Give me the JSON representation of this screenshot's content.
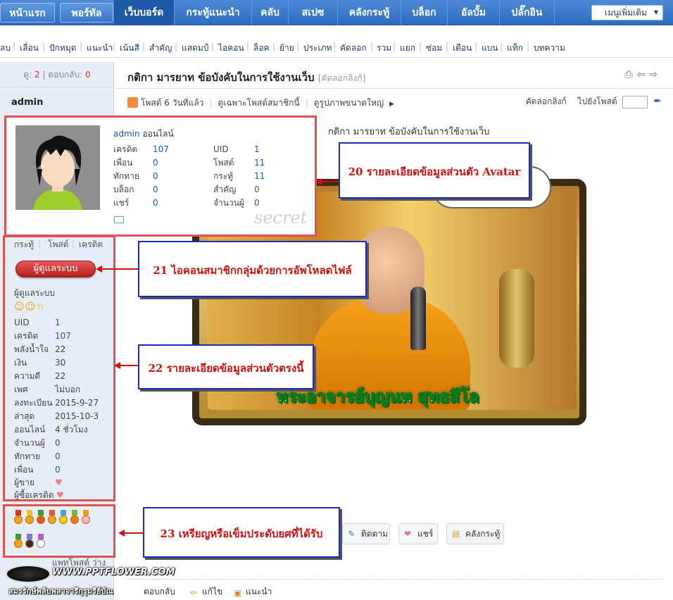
{
  "nav": {
    "items": [
      "หน้าแรก",
      "พอร์ทัล",
      "เว็บบอร์ด",
      "กระทู้แนะนำ",
      "คลับ",
      "สเปซ",
      "คลังกระทู้",
      "บล็อก",
      "อัลบั้ม",
      "ปลั๊กอิน"
    ],
    "more_menu": "เมนูเพิ่มเติม"
  },
  "modbar": {
    "items": [
      "ลบ",
      "เลื่อน",
      "ปักหมุด",
      "แนะนำ",
      "เน้นสี",
      "สำคัญ",
      "แสดมป์",
      "ไอคอน",
      "ล็อค",
      "ย้าย",
      "ประเภท",
      "คัดลอก",
      "รวม",
      "แยก",
      "ซ่อม",
      "เตือน",
      "แบน",
      "แท็ก",
      "บทความ"
    ]
  },
  "stats": {
    "views_label": "ดู:",
    "views": "2",
    "sep": "|",
    "replies_label": "ตอบกลับ:",
    "replies": "0"
  },
  "author": {
    "name": "admin"
  },
  "card": {
    "name": "admin",
    "status": "ออนไลน์",
    "rows": [
      [
        "เครดิต",
        "107",
        "UID",
        "1"
      ],
      [
        "เพื่อน",
        "0",
        "โพสต์",
        "11"
      ],
      [
        "ทักทาย",
        "0",
        "กระทู้",
        "11"
      ],
      [
        "บล็อก",
        "0",
        "สำคัญ",
        "0"
      ],
      [
        "แชร์",
        "0",
        "จำนวนผู้",
        "0"
      ]
    ],
    "watermark": "secret"
  },
  "side_tabs": [
    "กระทู้",
    "โพสต์",
    "เครดิต"
  ],
  "group": {
    "button": "ผู้ดูแลระบบ",
    "label": "ผู้ดูแลระบบ",
    "stars": "☺☺☆"
  },
  "profile": [
    [
      "UID",
      "1"
    ],
    [
      "เครดิต",
      "107"
    ],
    [
      "พลังน้ำใจ",
      "22"
    ],
    [
      "เงิน",
      "30"
    ],
    [
      "ความดี",
      "22"
    ],
    [
      "เพศ",
      "ไม่บอก"
    ],
    [
      "ลงทะเบียน",
      "2015-9-27"
    ],
    [
      "ล่าสุด",
      "2015-10-3"
    ],
    [
      "ออนไลน์",
      "4 ชั่วโมง"
    ],
    [
      "จำนวนผู้",
      "0"
    ],
    [
      "ทักทาย",
      "0"
    ],
    [
      "เพื่อน",
      "0"
    ],
    [
      "ผู้ขาย",
      "♥"
    ],
    [
      "ผู้ซื้อเครดิต",
      "♥"
    ]
  ],
  "watermark": {
    "url": "WWW.PPTFLOWER.COM",
    "thai": "สมรรักษ์พลับพลาจารึกุรุมรีย์บัณ",
    "behind": "แพทโพสต์ ว่าง"
  },
  "post": {
    "title": "กติกา มารยาท ข้อบังคับในการใช้งานเว็บ",
    "copy_link": "[คัดลอกลิงก์]",
    "meta_posted": "โพสต์ 6 วันที่แล้ว",
    "meta_only_author": "ดูเฉพาะโพสต์สมาชิกนี้",
    "meta_large_image": "ดูรูปภาพขนาดใหญ่",
    "meta_arrow": "▶",
    "copy": "คัดลอกลิงก์",
    "goto": "ไปยังโพสต์",
    "body_heading": "กติกา มารยาท ข้อบังคับในการใช้งานเว็บ",
    "image_caption": "พระอาจารย์บุญนพ สุทธสีโล"
  },
  "callouts": {
    "c20": "20 รายละเอียดข้อมูลส่วนตัว Avatar",
    "c21": "21 ไอคอนสมาชิกกลุ่มด้วยการอัพโหลดไฟล์",
    "c22": "22 รายละเอียดข้อมูลส่วนตัวตรงนี้",
    "c23": "23 เหรียญหรือเข็มประดับยศที่ได้รับ"
  },
  "actions": {
    "follow": "ติดตาม",
    "share": "แชร์",
    "collect": "คลังกระทู้"
  },
  "bottom": {
    "reply": "ตอบกลับ",
    "edit": "แก้ไข",
    "recommend": "แนะนำ"
  },
  "colors": {
    "nav": "#2f6cc0",
    "callout_border": "#1a2fb5",
    "callout_text": "#d01010",
    "highlight_box": "#e05252"
  }
}
